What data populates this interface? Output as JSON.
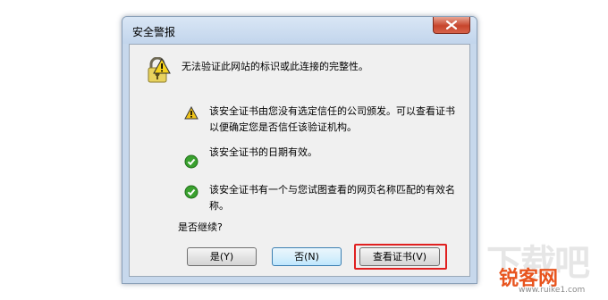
{
  "dialog": {
    "title": "安全警报",
    "header_message": "无法验证此网站的标识或此连接的完整性。",
    "items": [
      {
        "icon": "warning-icon",
        "text": "该安全证书由您没有选定信任的公司颁发。可以查看证书以便确定您是否信任该验证机构。"
      },
      {
        "icon": "check-icon",
        "text": "该安全证书的日期有效。"
      },
      {
        "icon": "check-icon",
        "text": "该安全证书有一个与您试图查看的网页名称匹配的有效名称。"
      }
    ],
    "question": "是否继续?",
    "buttons": {
      "yes": "是(Y)",
      "no": "否(N)",
      "view_cert": "查看证书(V)"
    }
  },
  "watermark": {
    "brand": "锐客网",
    "url": "www.ruike1.com"
  },
  "colors": {
    "highlight": "#e02020",
    "check": "#3aa12f",
    "warning": "#f0c419"
  }
}
